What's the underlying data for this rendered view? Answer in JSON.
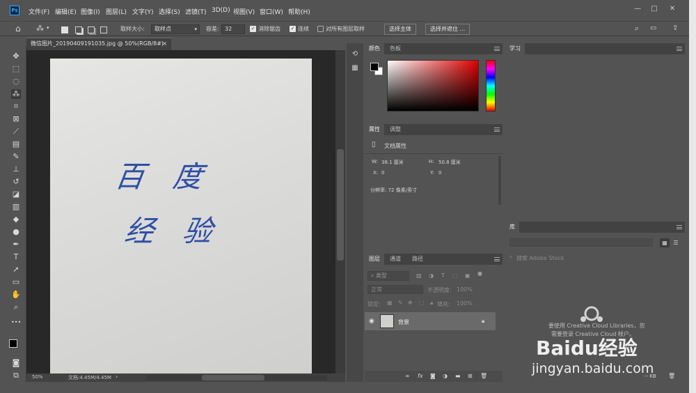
{
  "app": {
    "logo": "Ps"
  },
  "menu": [
    "文件(F)",
    "编辑(E)",
    "图像(I)",
    "图层(L)",
    "文字(Y)",
    "选择(S)",
    "滤镜(T)",
    "3D(D)",
    "视图(V)",
    "窗口(W)",
    "帮助(H)"
  ],
  "window_controls": {
    "minimize": "—",
    "maximize": "□",
    "close": "✕"
  },
  "options": {
    "sample_size_label": "取样大小:",
    "sample_size_value": "取样点",
    "tolerance_label": "容差:",
    "tolerance_value": "32",
    "antialias_label": "消除锯齿",
    "antialias_checked": true,
    "contiguous_label": "连续",
    "contiguous_checked": true,
    "sample_all_label": "对所有图层取样",
    "sample_all_checked": false,
    "select_subject": "选择主体",
    "select_mask": "选择并遮住 ..."
  },
  "document": {
    "tab_title": "微信图片_20190409191035.jpg @ 50%(RGB/8#)",
    "close": "×",
    "handwriting_line1": "百 度",
    "handwriting_line2": "经 验",
    "zoom": "50%",
    "doc_size": "文档:4.45M/4.45M"
  },
  "color_panel": {
    "tabs": [
      "颜色",
      "色板"
    ]
  },
  "properties_panel": {
    "tabs": [
      "属性",
      "调整"
    ],
    "section": "文档属性",
    "w_label": "W:",
    "w_value": "38.1 厘米",
    "h_label": "H:",
    "h_value": "50.8 厘米",
    "x_label": "X:",
    "x_value": "0",
    "y_label": "Y:",
    "y_value": "0",
    "resolution": "分辨率: 72 像素/英寸"
  },
  "layers_panel": {
    "tabs": [
      "图层",
      "通道",
      "路径"
    ],
    "filter_label": "类型",
    "blend_mode": "正常",
    "opacity_label": "不透明度:",
    "opacity_value": "100%",
    "lock_label": "锁定:",
    "fill_label": "填充:",
    "fill_value": "100%",
    "layer_name": "背景"
  },
  "learn_panel": {
    "tab": "学习"
  },
  "library_panel": {
    "tab": "库",
    "search_placeholder": "搜索 Adobe Stock",
    "message_line1": "要使用 Creative Cloud Libraries，您",
    "message_line2": "需要登录 Creative Cloud 帐户。",
    "size": "-- KB"
  },
  "watermark": {
    "brand": "Baidu经验",
    "url": "jingyan.baidu.com"
  },
  "colors": {
    "accent": "#31a8ff",
    "ink": "#2f4fa6",
    "panel": "#535353"
  }
}
